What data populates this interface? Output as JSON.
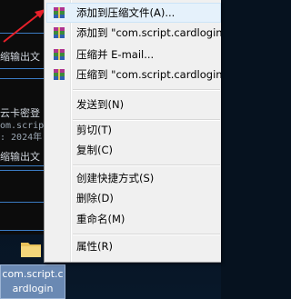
{
  "background": {
    "terminal_lines": [
      "缩输出文",
      "云卡密登",
      "om.scrip",
      ": 2024年",
      "缩输出文"
    ],
    "desktop_file": {
      "name_line1": "com.script.c",
      "name_line2": "ardlogin"
    }
  },
  "context_menu": {
    "winrar_items": [
      {
        "label": "添加到压缩文件(A)..."
      },
      {
        "label": "添加到 \"com.script.cardlogin"
      },
      {
        "label": "压缩并 E-mail..."
      },
      {
        "label": "压缩到 \"com.script.cardlogin"
      }
    ],
    "send_to": "发送到(N)",
    "cut": "剪切(T)",
    "copy": "复制(C)",
    "create_shortcut": "创建快捷方式(S)",
    "delete": "删除(D)",
    "rename": "重命名(M)",
    "properties": "属性(R)"
  },
  "colors": {
    "menu_bg": "#f0f0f0",
    "highlight_bg": "#e5f1fb",
    "arrow": "#e8202a",
    "selection": "#6a89b3"
  },
  "icons": [
    "winrar-icon",
    "folder-icon",
    "red-arrow"
  ]
}
